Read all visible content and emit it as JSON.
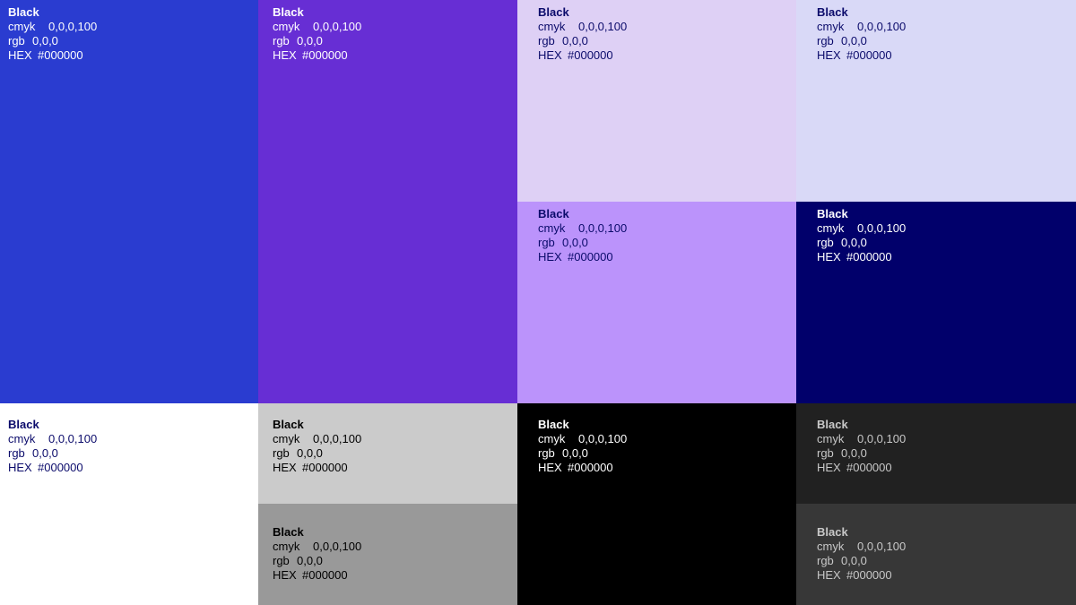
{
  "swatches": [
    {
      "name": "Black",
      "cmyk_label": "cmyk",
      "cmyk": "0,0,0,100",
      "rgb_label": "rgb",
      "rgb": "0,0,0",
      "hex_label": "HEX",
      "hex": "#000000",
      "bg": "#2a3cd0",
      "fg": "#ffffff"
    },
    {
      "name": "Black",
      "cmyk_label": "cmyk",
      "cmyk": "0,0,0,100",
      "rgb_label": "rgb",
      "rgb": "0,0,0",
      "hex_label": "HEX",
      "hex": "#000000",
      "bg": "#672ed4",
      "fg": "#ffffff"
    },
    {
      "name": "Black",
      "cmyk_label": "cmyk",
      "cmyk": "0,0,0,100",
      "rgb_label": "rgb",
      "rgb": "0,0,0",
      "hex_label": "HEX",
      "hex": "#000000",
      "bg": "#ded0f5",
      "fg": "#0b0b6b"
    },
    {
      "name": "Black",
      "cmyk_label": "cmyk",
      "cmyk": "0,0,0,100",
      "rgb_label": "rgb",
      "rgb": "0,0,0",
      "hex_label": "HEX",
      "hex": "#000000",
      "bg": "#d9d9f7",
      "fg": "#0b0b6b"
    },
    {
      "name": "Black",
      "cmyk_label": "cmyk",
      "cmyk": "0,0,0,100",
      "rgb_label": "rgb",
      "rgb": "0,0,0",
      "hex_label": "HEX",
      "hex": "#000000",
      "bg": "#bb93fb",
      "fg": "#0b0b6b"
    },
    {
      "name": "Black",
      "cmyk_label": "cmyk",
      "cmyk": "0,0,0,100",
      "rgb_label": "rgb",
      "rgb": "0,0,0",
      "hex_label": "HEX",
      "hex": "#000000",
      "bg": "#01006b",
      "fg": "#ffffff"
    },
    {
      "name": "Black",
      "cmyk_label": "cmyk",
      "cmyk": "0,0,0,100",
      "rgb_label": "rgb",
      "rgb": "0,0,0",
      "hex_label": "HEX",
      "hex": "#000000",
      "bg": "#ffffff",
      "fg": "#0b0b6b"
    },
    {
      "name": "Black",
      "cmyk_label": "cmyk",
      "cmyk": "0,0,0,100",
      "rgb_label": "rgb",
      "rgb": "0,0,0",
      "hex_label": "HEX",
      "hex": "#000000",
      "bg": "#cbcbcb",
      "fg": "#000000"
    },
    {
      "name": "Black",
      "cmyk_label": "cmyk",
      "cmyk": "0,0,0,100",
      "rgb_label": "rgb",
      "rgb": "0,0,0",
      "hex_label": "HEX",
      "hex": "#000000",
      "bg": "#999999",
      "fg": "#000000"
    },
    {
      "name": "Black",
      "cmyk_label": "cmyk",
      "cmyk": "0,0,0,100",
      "rgb_label": "rgb",
      "rgb": "0,0,0",
      "hex_label": "HEX",
      "hex": "#000000",
      "bg": "#000000",
      "fg": "#ffffff"
    },
    {
      "name": "Black",
      "cmyk_label": "cmyk",
      "cmyk": "0,0,0,100",
      "rgb_label": "rgb",
      "rgb": "0,0,0",
      "hex_label": "HEX",
      "hex": "#000000",
      "bg": "#212121",
      "fg": "#c8c8c8"
    },
    {
      "name": "Black",
      "cmyk_label": "cmyk",
      "cmyk": "0,0,0,100",
      "rgb_label": "rgb",
      "rgb": "0,0,0",
      "hex_label": "HEX",
      "hex": "#000000",
      "bg": "#373737",
      "fg": "#c8c8c8"
    }
  ]
}
